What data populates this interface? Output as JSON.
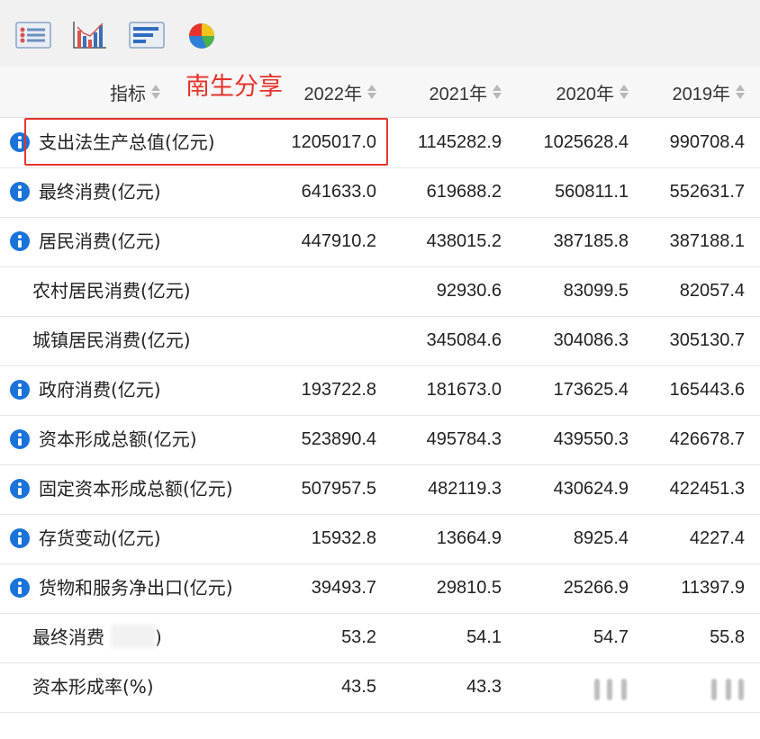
{
  "toolbar": {
    "icons": [
      "table-view-icon",
      "bar-chart-icon",
      "horizontal-bar-icon",
      "pie-chart-icon"
    ]
  },
  "header": {
    "indicator_label": "指标",
    "years": [
      "2022年",
      "2021年",
      "2020年",
      "2019年"
    ]
  },
  "watermark": "南生分享",
  "rows": [
    {
      "name": "支出法生产总值(亿元)",
      "values": [
        "1205017.0",
        "1145282.9",
        "1025628.4",
        "990708.4"
      ]
    },
    {
      "name": "最终消费(亿元)",
      "values": [
        "641633.0",
        "619688.2",
        "560811.1",
        "552631.7"
      ]
    },
    {
      "name": "居民消费(亿元)",
      "values": [
        "447910.2",
        "438015.2",
        "387185.8",
        "387188.1"
      ]
    },
    {
      "name": "农村居民消费(亿元)",
      "values": [
        "",
        "92930.6",
        "83099.5",
        "82057.4"
      ]
    },
    {
      "name": "城镇居民消费(亿元)",
      "values": [
        "",
        "345084.6",
        "304086.3",
        "305130.7"
      ]
    },
    {
      "name": "政府消费(亿元)",
      "values": [
        "193722.8",
        "181673.0",
        "173625.4",
        "165443.6"
      ]
    },
    {
      "name": "资本形成总额(亿元)",
      "values": [
        "523890.4",
        "495784.3",
        "439550.3",
        "426678.7"
      ]
    },
    {
      "name": "固定资本形成总额(亿元)",
      "values": [
        "507957.5",
        "482119.3",
        "430624.9",
        "422451.3"
      ]
    },
    {
      "name": "存货变动(亿元)",
      "values": [
        "15932.8",
        "13664.9",
        "8925.4",
        "4227.4"
      ]
    },
    {
      "name": "货物和服务净出口(亿元)",
      "values": [
        "39493.7",
        "29810.5",
        "25266.9",
        "11397.9"
      ]
    },
    {
      "name": "最终消费",
      "name_suffix": ")",
      "values": [
        "53.2",
        "54.1",
        "54.7",
        "55.8"
      ]
    },
    {
      "name": "资本形成率(%)",
      "values": [
        "43.5",
        "43.3",
        "",
        ""
      ]
    }
  ]
}
